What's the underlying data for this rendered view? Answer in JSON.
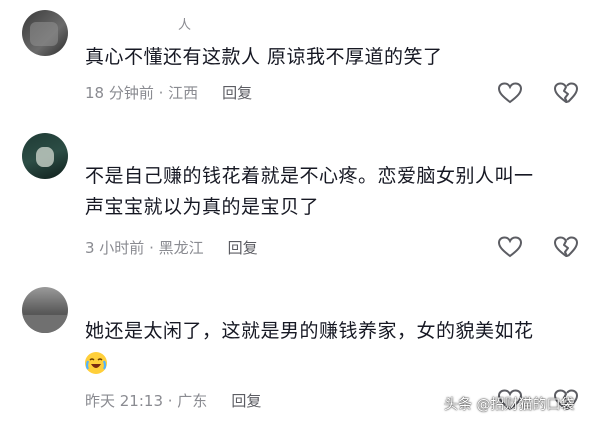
{
  "comments": [
    {
      "username": "人",
      "text": "真心不懂还有这款人  原谅我不厚道的笑了",
      "time": "18 分钟前 · 江西",
      "reply": "回复"
    },
    {
      "username": "",
      "text_line1": "不是自己赚的钱花着就是不心疼。恋爱脑女别人叫一",
      "text_line2": "声宝宝就以为真的是宝贝了",
      "time": "3 小时前 · 黑龙江",
      "reply": "回复"
    },
    {
      "username": "",
      "text": "她还是太闲了，这就是男的赚钱养家，女的貌美如花",
      "emoji": "loudly-crying-laughing-emoji",
      "time": "昨天 21:13 · 广东",
      "reply": "回复"
    }
  ],
  "icons": {
    "like": "heart-outline-icon",
    "dislike": "broken-heart-icon"
  },
  "watermark": "头条 @招财猫的口袋",
  "colors": {
    "text": "#161823",
    "meta": "#8a8b91",
    "icon": "#5c5d63"
  }
}
